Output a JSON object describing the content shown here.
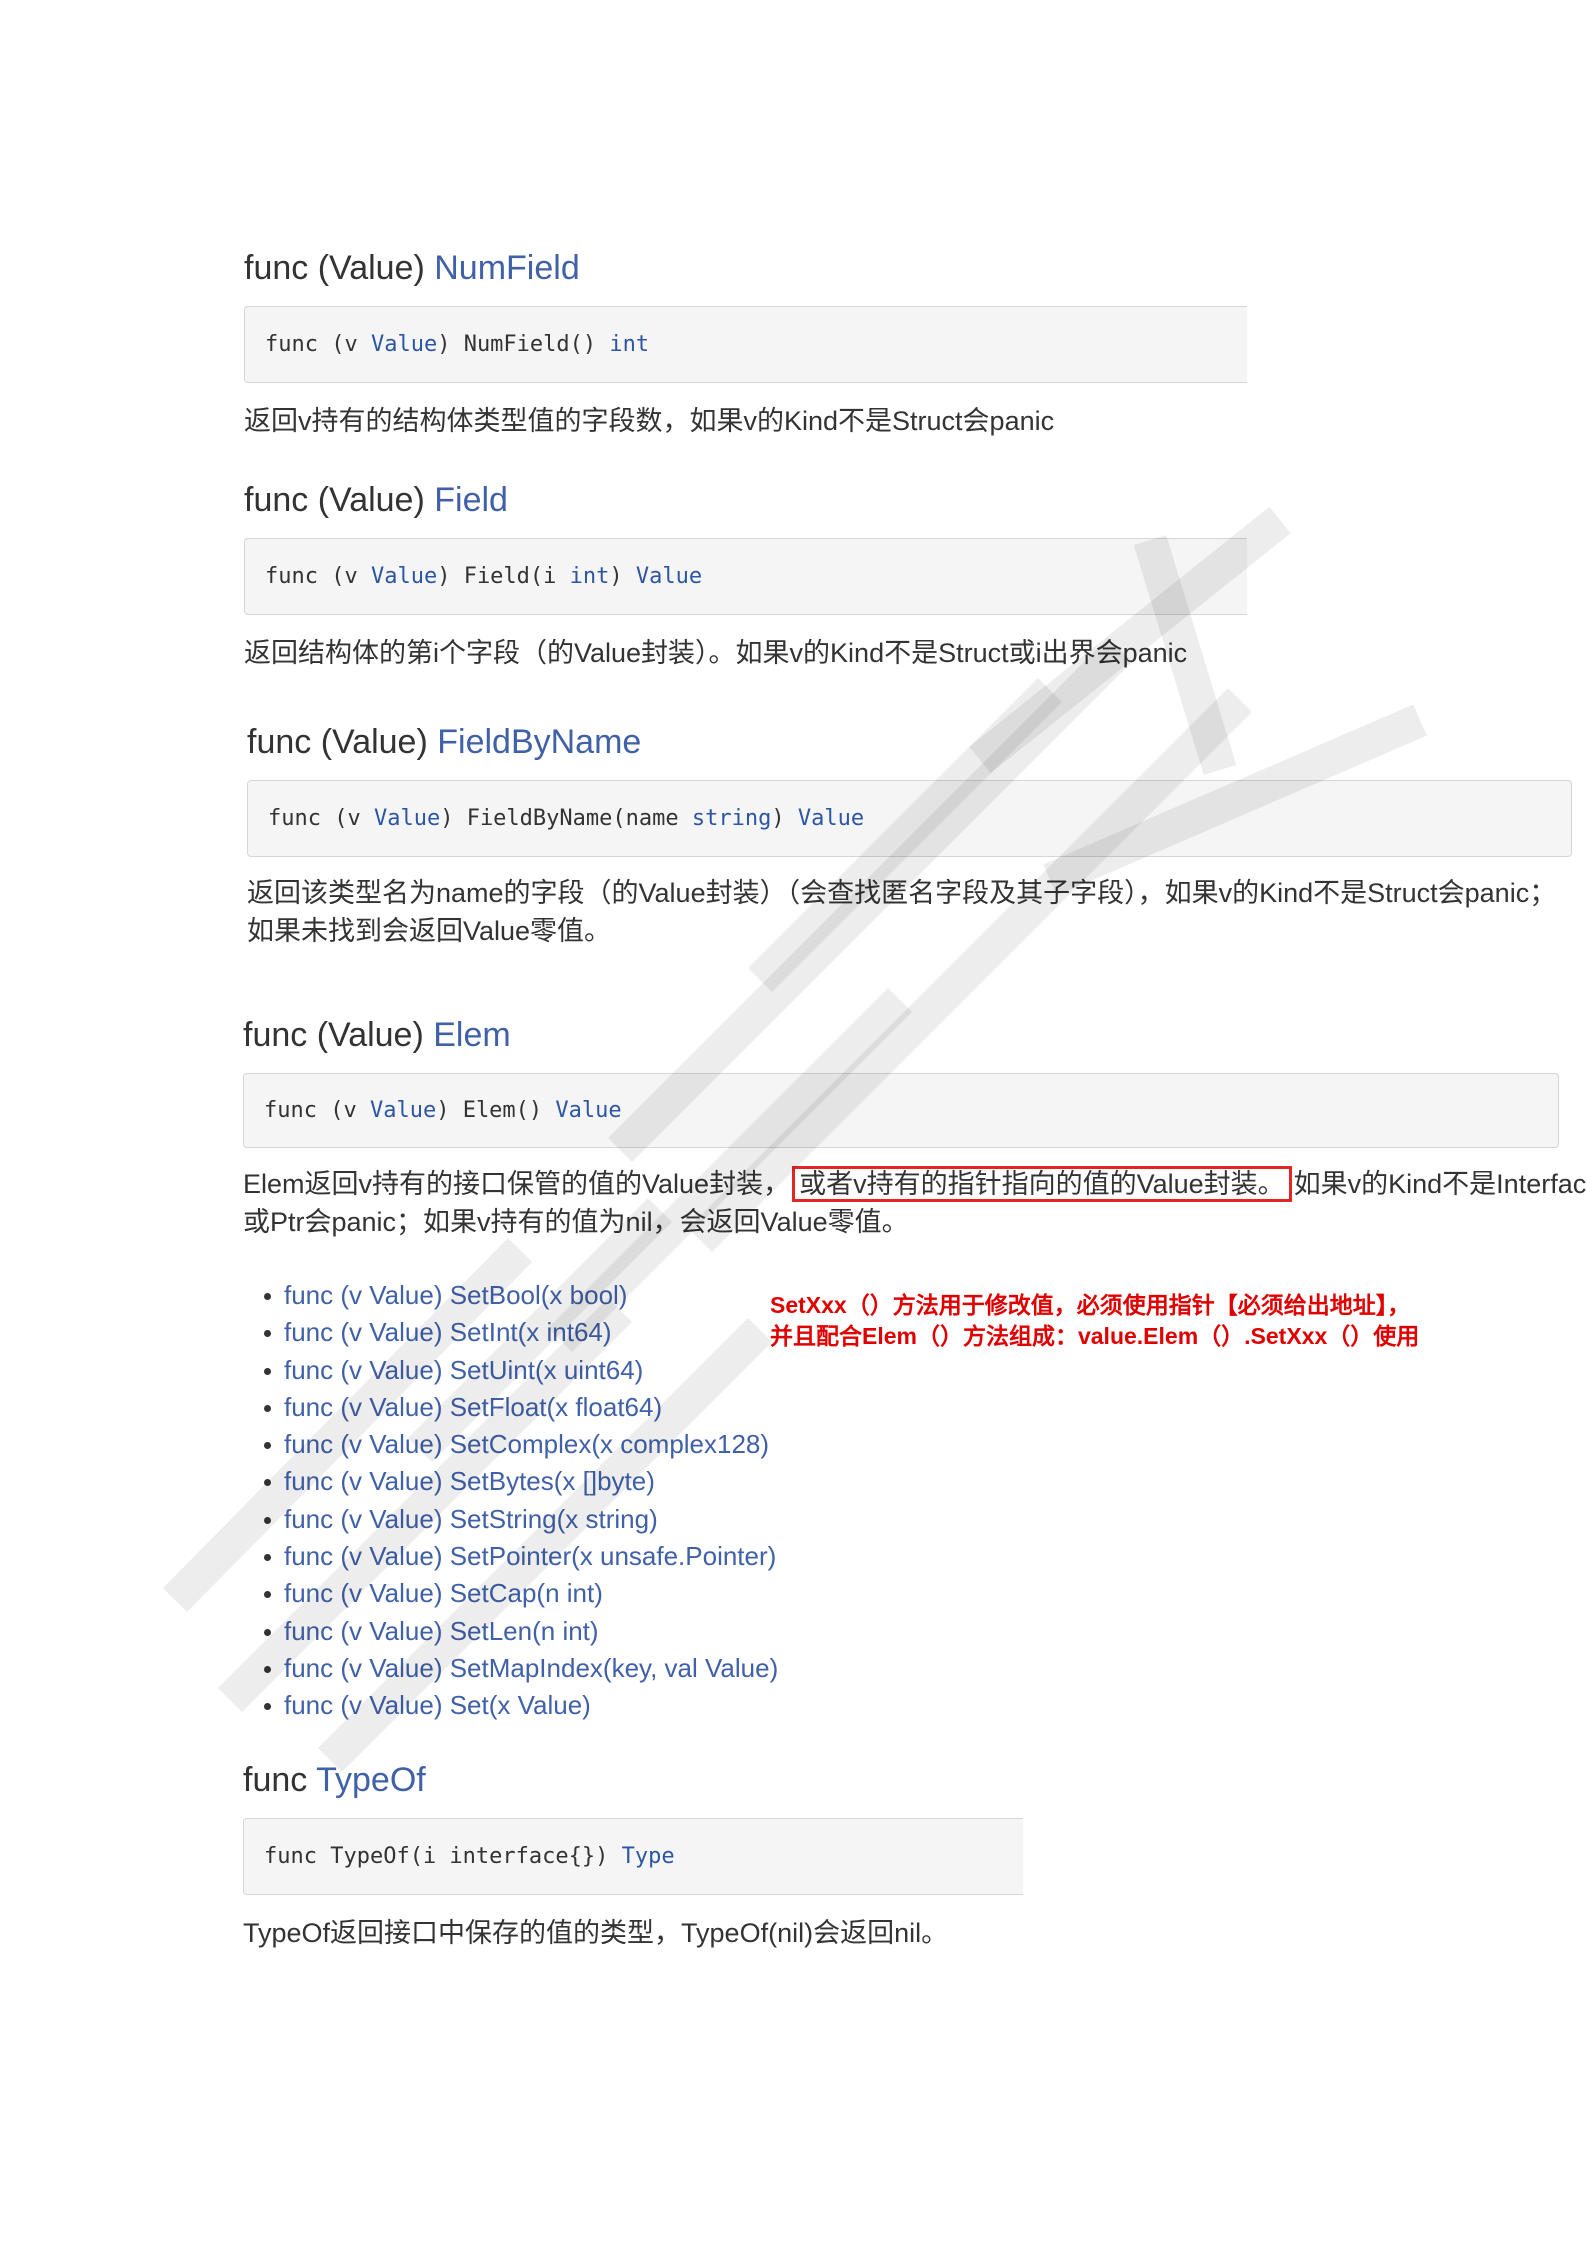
{
  "sections": {
    "numfield": {
      "heading_prefix": "func (Value) ",
      "heading_link": "NumField",
      "code": {
        "p1": "func (v ",
        "t1": "Value",
        "p2": ") NumField() ",
        "t2": "int"
      },
      "desc": "返回v持有的结构体类型值的字段数，如果v的Kind不是Struct会panic"
    },
    "field": {
      "heading_prefix": "func (Value) ",
      "heading_link": "Field",
      "code": {
        "p1": "func (v ",
        "t1": "Value",
        "p2": ") Field(i ",
        "t2": "int",
        "p3": ") ",
        "t3": "Value"
      },
      "desc": "返回结构体的第i个字段（的Value封装）。如果v的Kind不是Struct或i出界会panic"
    },
    "fieldbyname": {
      "heading_prefix": "func (Value) ",
      "heading_link": "FieldByName",
      "code": {
        "p1": "func (v ",
        "t1": "Value",
        "p2": ") FieldByName(name ",
        "t2": "string",
        "p3": ") ",
        "t3": "Value"
      },
      "desc_line1": "返回该类型名为name的字段（的Value封装）（会查找匿名字段及其子字段），如果v的Kind不是Struct会panic；",
      "desc_line2": "如果未找到会返回Value零值。"
    },
    "elem": {
      "heading_prefix": "func (Value) ",
      "heading_link": "Elem",
      "code": {
        "p1": "func (v ",
        "t1": "Value",
        "p2": ") Elem() ",
        "t2": "Value"
      },
      "desc_before": "Elem返回v持有的接口保管的值的Value封装，",
      "desc_highlight": "或者v持有的指针指向的值的Value封装。",
      "desc_after": "如果v的Kind不是Interface",
      "desc_line2": "或Ptr会panic；如果v持有的值为nil，会返回Value零值。"
    },
    "typeof": {
      "heading_prefix": "func ",
      "heading_link": "TypeOf",
      "code": {
        "p1": "func TypeOf(i interface{}) ",
        "t1": "Type"
      },
      "desc": "TypeOf返回接口中保存的值的类型，TypeOf(nil)会返回nil。"
    }
  },
  "methods": [
    "func (v Value) SetBool(x bool)",
    "func (v Value) SetInt(x int64)",
    "func (v Value) SetUint(x uint64)",
    "func (v Value) SetFloat(x float64)",
    "func (v Value) SetComplex(x complex128)",
    "func (v Value) SetBytes(x []byte)",
    "func (v Value) SetString(x string)",
    "func (v Value) SetPointer(x unsafe.Pointer)",
    "func (v Value) SetCap(n int)",
    "func (v Value) SetLen(n int)",
    "func (v Value) SetMapIndex(key, val Value)",
    "func (v Value) Set(x Value)"
  ],
  "note": {
    "line1": "SetXxx（）方法用于修改值，必须使用指针【必须给出地址】，",
    "line2": "并且配合Elem（）方法组成：value.Elem（）.SetXxx（）使用"
  },
  "colors": {
    "link": "#4060a8",
    "code_type": "#2c56a3",
    "note_red": "#e00000",
    "highlight_border": "#e52424"
  }
}
